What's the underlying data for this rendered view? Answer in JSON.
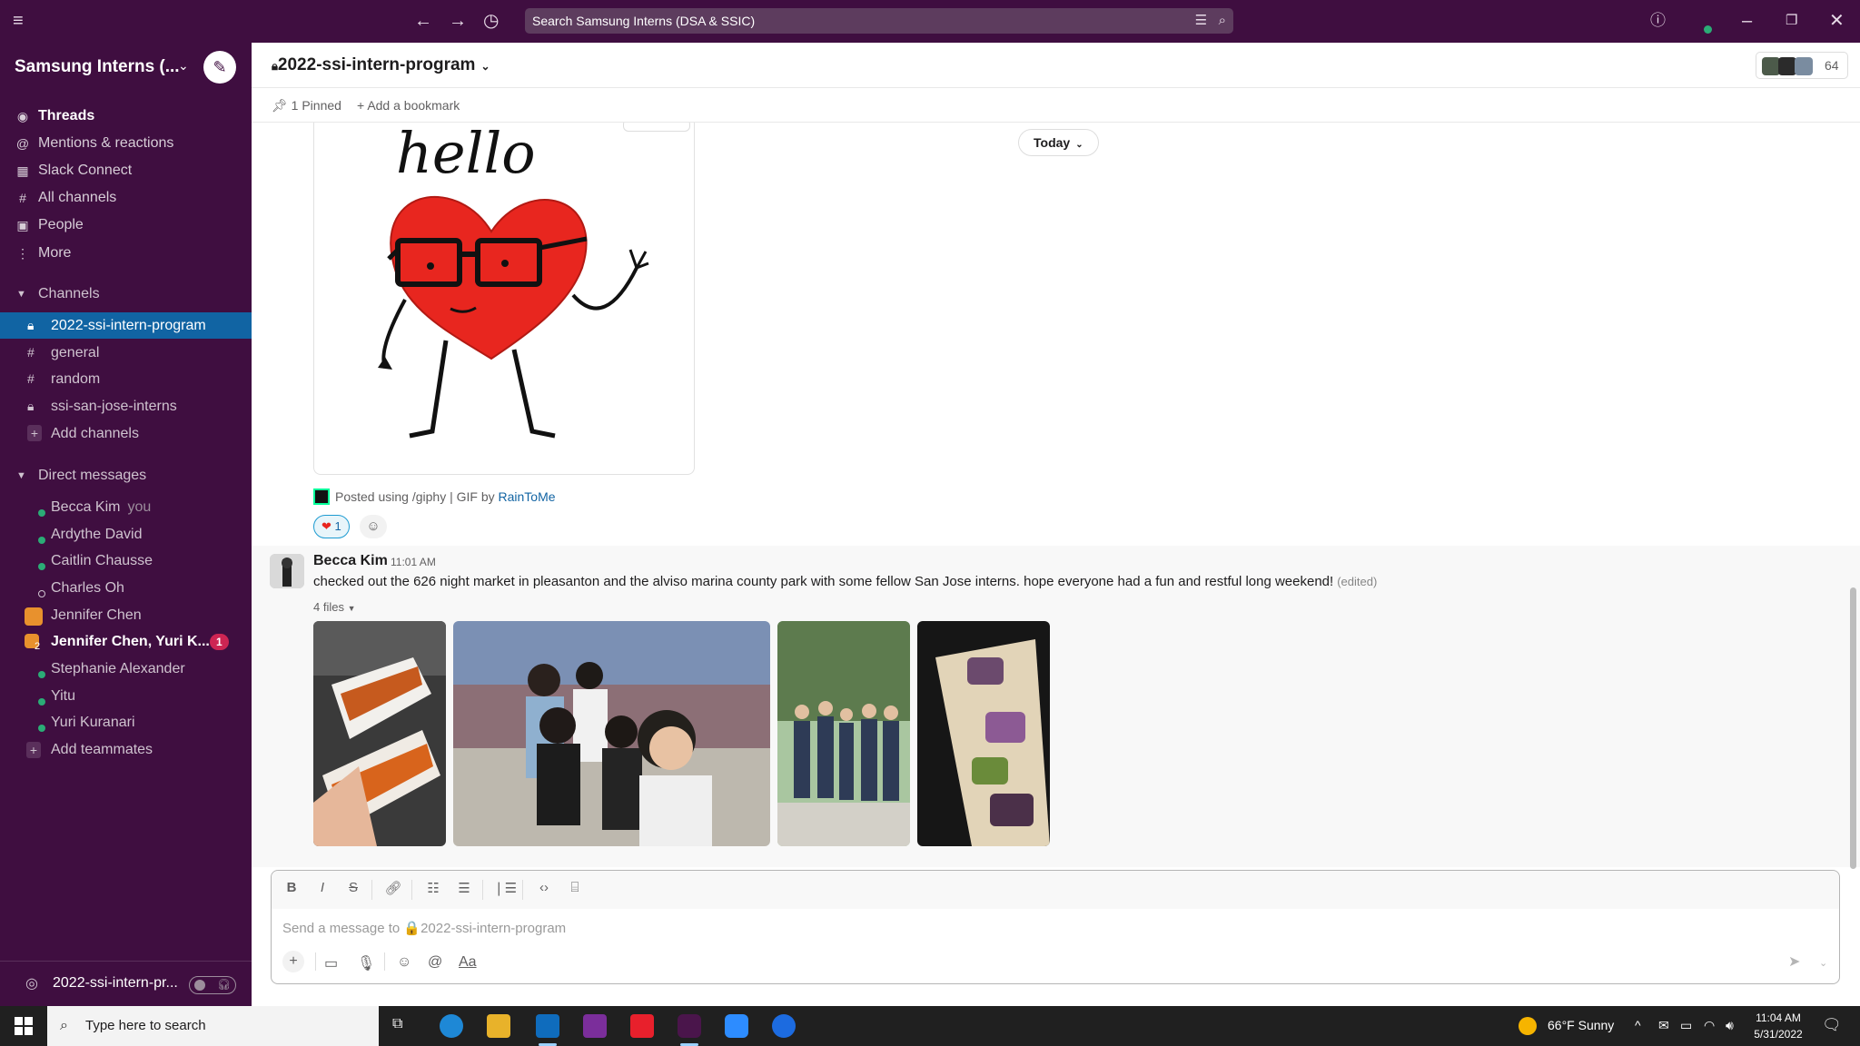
{
  "topbar": {
    "search_text": "Search Samsung Interns (DSA & SSIC)"
  },
  "sidebar": {
    "workspace_name": "Samsung Interns (...",
    "nav": [
      {
        "label": "Threads",
        "icon": "threads-icon"
      },
      {
        "label": "Mentions & reactions",
        "icon": "at-icon"
      },
      {
        "label": "Slack Connect",
        "icon": "building-icon"
      },
      {
        "label": "All channels",
        "icon": "channels-icon"
      },
      {
        "label": "People",
        "icon": "people-icon"
      },
      {
        "label": "More",
        "icon": "more-icon"
      }
    ],
    "channels_header": "Channels",
    "channels": [
      {
        "label": "2022-ssi-intern-program",
        "private": true
      },
      {
        "label": "general",
        "private": false
      },
      {
        "label": "random",
        "private": false
      },
      {
        "label": "ssi-san-jose-interns",
        "private": true
      }
    ],
    "add_channels": "Add channels",
    "dms_header": "Direct messages",
    "dms": [
      {
        "label": "Becca Kim",
        "suffix": "you"
      },
      {
        "label": "Ardythe David"
      },
      {
        "label": "Caitlin Chausse"
      },
      {
        "label": "Charles Oh"
      },
      {
        "label": "Jennifer Chen"
      },
      {
        "label": "Jennifer Chen, Yuri K...",
        "badge": "1",
        "group_count": "2"
      },
      {
        "label": "Stephanie Alexander"
      },
      {
        "label": "Yitu"
      },
      {
        "label": "Yuri Kuranari"
      }
    ],
    "add_teammates": "Add teammates",
    "huddle_channel": "2022-ssi-intern-pr..."
  },
  "channel": {
    "name": "2022-ssi-intern-program",
    "member_count": "64",
    "pinned": "1 Pinned",
    "add_bookmark": "Add a bookmark"
  },
  "messages": {
    "gif_text": "hello",
    "gif_caption_prefix": "Posted using /giphy | GIF by ",
    "gif_caption_link": "RainToMe",
    "reaction_count": "1",
    "date_divider": "Today",
    "message": {
      "author": "Becca Kim",
      "time": "11:01 AM",
      "text": "checked out the 626 night market in pleasanton and the alviso marina county park with some fellow San Jose interns. hope everyone had a fun and restful long weekend!",
      "edited": "(edited)",
      "files_label": "4 files"
    }
  },
  "composer": {
    "placeholder": "Send a message to 🔒2022-ssi-intern-program"
  },
  "taskbar": {
    "search_placeholder": "Type here to search",
    "weather": "66°F  Sunny",
    "time": "11:04 AM",
    "date": "5/31/2022"
  },
  "colors": {
    "sidebar_bg": "#3f0e40",
    "active_channel": "#1164a3",
    "badge": "#cd2553",
    "online": "#2bac76",
    "link": "#1264a3"
  }
}
